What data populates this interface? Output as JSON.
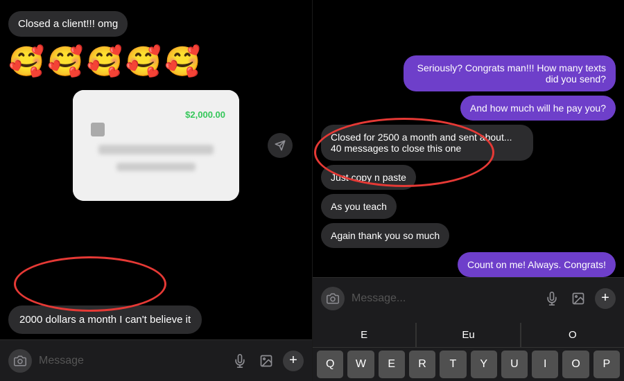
{
  "left": {
    "msg1": "Closed a client!!! omg",
    "emojis": "🥰🥰🥰🥰🥰",
    "amount": "$2,000.00",
    "msg2": "2000 dollars a month I can't believe it",
    "input_placeholder": "Message",
    "send_icon": "➤"
  },
  "right": {
    "msg_right1": "Seriously? Congrats man!!! How many texts did you send?",
    "msg_right2": "And how much will he pay you?",
    "msg_left1": "Closed for 2500 a month and sent about... 40 messages to close this one",
    "msg_left2": "Just copy n paste",
    "msg_left3": "As you teach",
    "msg_left4": "Again thank you so much",
    "msg_right3": "Count on me! Always. Congrats!",
    "input_placeholder": "Message...",
    "keyboard_suggestions": [
      "E",
      "Eu",
      "O"
    ],
    "keyboard_row1": [
      "Q",
      "W",
      "E",
      "R",
      "T",
      "Y",
      "U",
      "I",
      "O",
      "P"
    ]
  }
}
